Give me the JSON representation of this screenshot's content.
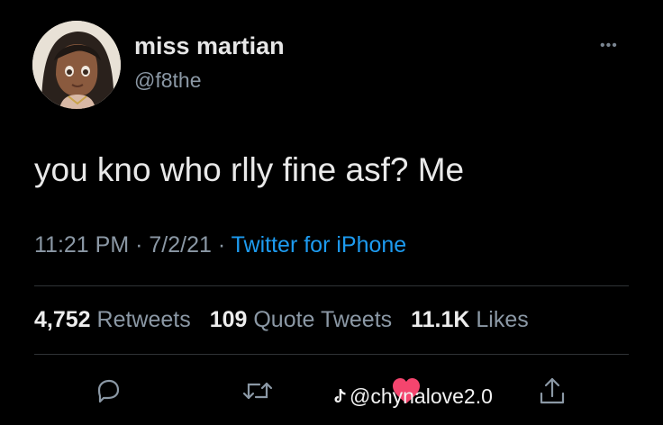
{
  "profile": {
    "display_name": "miss martian",
    "handle": "@f8the"
  },
  "tweet": {
    "text": "you kno who rlly fine asf? Me",
    "time": "11:21 PM",
    "date": "7/2/21",
    "source": "Twitter for iPhone",
    "separator": " · "
  },
  "stats": {
    "retweets_count": "4,752",
    "retweets_label": "Retweets",
    "quotes_count": "109",
    "quotes_label": "Quote Tweets",
    "likes_count": "11.1K",
    "likes_label": "Likes"
  },
  "watermark": {
    "text": "@chynalove2.0"
  },
  "icons": {
    "reply": "reply-icon",
    "retweet": "retweet-icon",
    "like": "heart-icon",
    "share": "share-icon",
    "more": "more-icon",
    "tiktok": "tiktok-icon"
  },
  "colors": {
    "background": "#000000",
    "link": "#1d9bf0",
    "secondary_text": "#8b98a5",
    "like_active": "#f4456e"
  }
}
